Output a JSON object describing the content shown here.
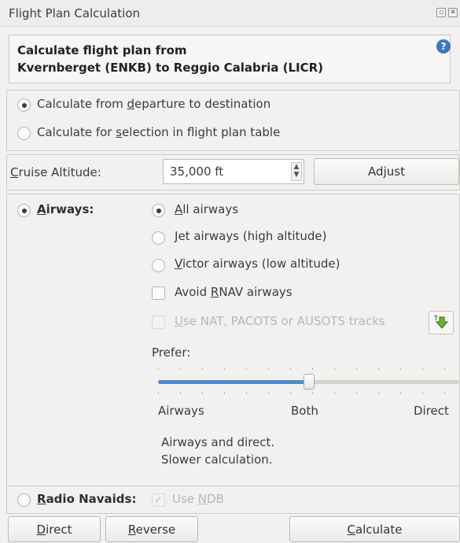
{
  "window": {
    "title": "Flight Plan Calculation"
  },
  "header": {
    "line1": "Calculate flight plan from",
    "line2": "Kvernberget (ENKB) to Reggio Calabria (LICR)",
    "help_glyph": "?"
  },
  "mode": {
    "option1": {
      "pre": "Calculate from ",
      "ul": "d",
      "post": "eparture to destination",
      "selected": true
    },
    "option2": {
      "pre": "Calculate for ",
      "ul": "s",
      "post": "election in flight plan table",
      "selected": false
    }
  },
  "cruise": {
    "label_ul": "C",
    "label_rest": "ruise Altitude:",
    "value": "35,000 ft",
    "adjust_pre": "Ad",
    "adjust_ul": "j",
    "adjust_post": "ust"
  },
  "airways": {
    "label_ul": "A",
    "label_rest": "irways:",
    "selected": true,
    "all": {
      "ul": "A",
      "rest": "ll airways",
      "selected": true
    },
    "jet": {
      "ul": "J",
      "rest": "et airways (high altitude)",
      "selected": false
    },
    "victor": {
      "ul": "V",
      "rest": "ictor airways (low altitude)",
      "selected": false
    },
    "avoid_rnav": {
      "pre": "Avoid ",
      "ul": "R",
      "rest": "NAV airways",
      "checked": false
    },
    "tracks": {
      "ul": "U",
      "rest": "se NAT, PACOTS or AUSOTS tracks",
      "checked": false,
      "enabled": false
    },
    "download_icon": "download-tracks-icon",
    "prefer_label": "Prefer:",
    "prefer_level": 0.5,
    "slider_labels": {
      "left": "Airways",
      "middle": "Both",
      "right": "Direct"
    },
    "description_line1": "Airways and direct.",
    "description_line2": "Slower calculation."
  },
  "navaids": {
    "label_ul": "R",
    "label_rest": "adio Navaids:",
    "selected": false,
    "use_ndb": {
      "pre": "Use ",
      "ul": "N",
      "rest": "DB",
      "checked": true,
      "enabled": false
    }
  },
  "buttons": {
    "direct": {
      "ul": "D",
      "rest": "irect"
    },
    "reverse": {
      "ul": "R",
      "rest": "everse"
    },
    "calculate": {
      "ul": "C",
      "rest": "alculate"
    }
  },
  "colors": {
    "accent": "#4e8dc9",
    "help": "#3a78c2"
  }
}
